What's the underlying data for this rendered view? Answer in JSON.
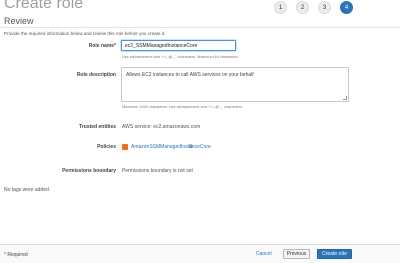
{
  "header": {
    "title": "Create role",
    "steps": [
      "1",
      "2",
      "3",
      "4"
    ],
    "active_step": "4"
  },
  "review": {
    "title": "Review",
    "instruction": "Provide the required information below and review this role before you create it."
  },
  "role_name": {
    "label": "Role name*",
    "value": "ec2_SSMManagedInstanceCore",
    "hint": "Use alphanumeric and '+=,.@-_' characters. Maximum 64 characters."
  },
  "role_description": {
    "label": "Role description",
    "value": "Allows EC2 instances to call AWS services on your behalf",
    "hint": "Maximum 1000 characters. Use alphanumeric and '+=,.@-_' characters."
  },
  "trusted_entities": {
    "label": "Trusted entities",
    "value": "AWS service: ec2.amazonaws.com"
  },
  "policies": {
    "label": "Policies",
    "items": [
      {
        "name": "AmazonSSMManagedInstanceCore",
        "icon": "policy-icon"
      }
    ],
    "external_icon": "external-link-icon"
  },
  "permissions_boundary": {
    "label": "Permissions boundary",
    "value": "Permissions boundary is not set"
  },
  "tags": {
    "note": "No tags were added."
  },
  "footer": {
    "required": "* Required",
    "cancel": "Cancel",
    "previous": "Previous",
    "create": "Create role"
  },
  "colors": {
    "accent": "#2e73b8",
    "policy_icon": "#e8701a"
  }
}
